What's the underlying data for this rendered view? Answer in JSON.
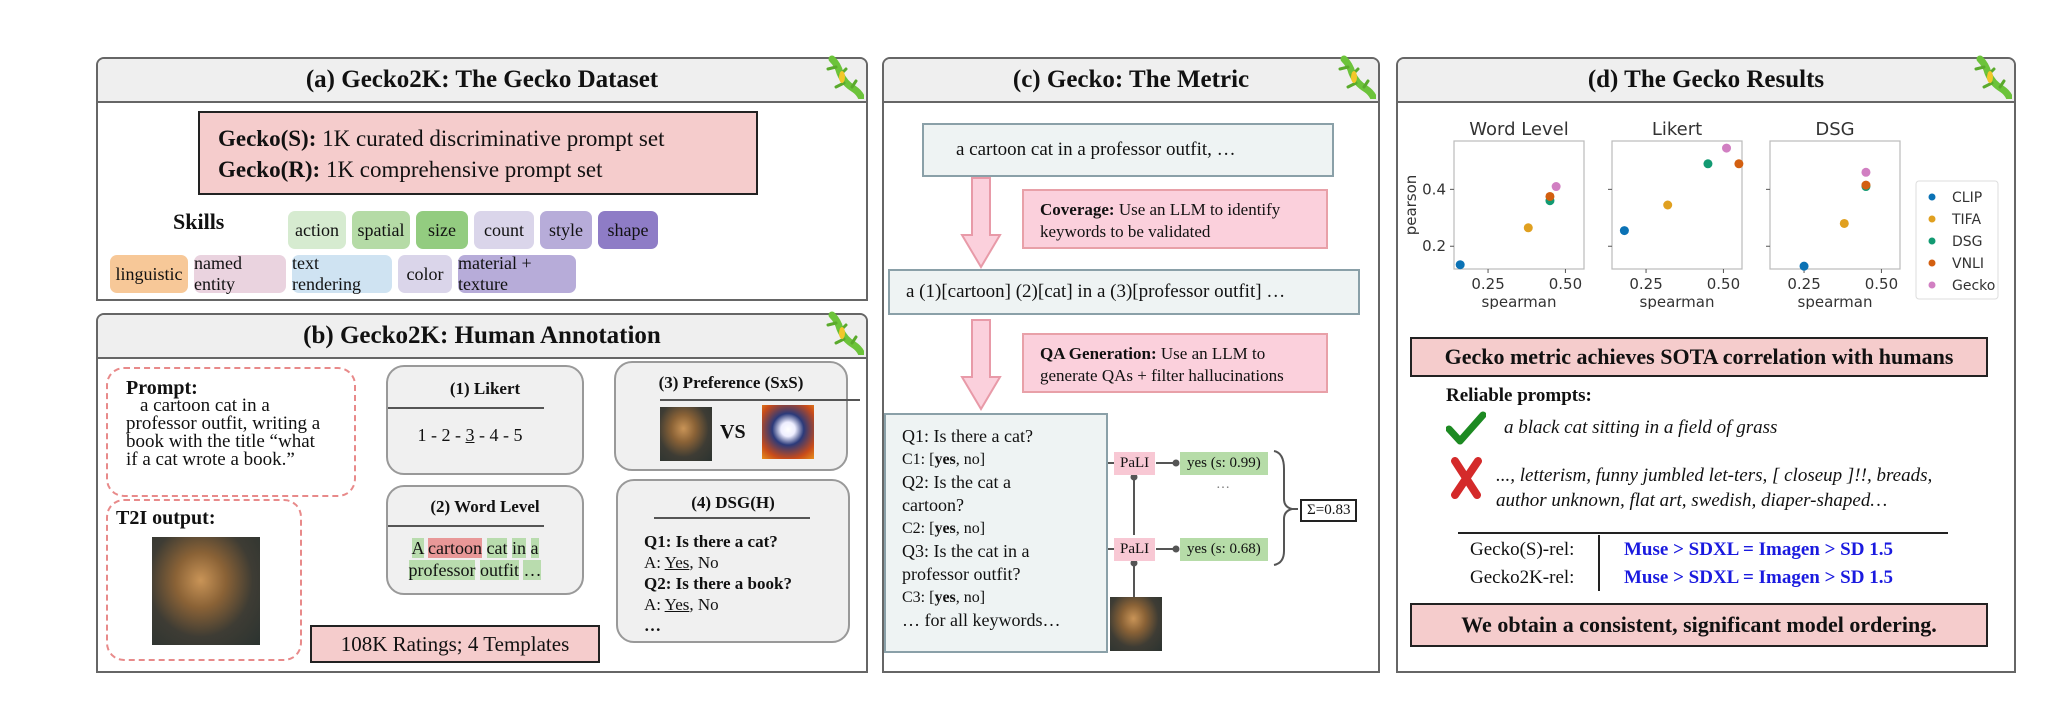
{
  "panel_a": {
    "title": "(a) Gecko2K: The Gecko Dataset",
    "sets": [
      {
        "name": "Gecko(S):",
        "desc": " 1K curated discriminative prompt set"
      },
      {
        "name": "Gecko(R):",
        "desc": " 1K comprehensive prompt set"
      }
    ],
    "skills_label": "Skills",
    "skills_row1": [
      {
        "label": "action",
        "color": "#d6ebd0"
      },
      {
        "label": "spatial",
        "color": "#b5dba6"
      },
      {
        "label": "size",
        "color": "#93cc80"
      },
      {
        "label": "count",
        "color": "#dad5ea"
      },
      {
        "label": "style",
        "color": "#b7acd9"
      },
      {
        "label": "shape",
        "color": "#8e7cc6"
      }
    ],
    "skills_row2": [
      {
        "label": "linguistic",
        "color": "#f7c898"
      },
      {
        "label": "named entity",
        "color": "#ead3df"
      },
      {
        "label": "text rendering",
        "color": "#cfe3f2"
      },
      {
        "label": "color",
        "color": "#dad5ea"
      },
      {
        "label": "material + texture",
        "color": "#b7acd9"
      }
    ]
  },
  "panel_b": {
    "title": "(b) Gecko2K: Human Annotation",
    "prompt_label": "Prompt:",
    "prompt_lines": [
      "a cartoon cat in a",
      "professor outfit, writing a",
      "book with the title “what",
      "if a cat wrote a book.”"
    ],
    "t2i_label": "T2I output:",
    "likert": {
      "title": "(1) Likert",
      "scale_pre": "1 - 2 - ",
      "scale_sel": "3",
      "scale_post": " - 4 - 5"
    },
    "word_level": {
      "title": "(2) Word Level",
      "line1": [
        {
          "w": "A",
          "ok": true
        },
        {
          "w": "cartoon",
          "ok": false
        },
        {
          "w": "cat",
          "ok": true
        },
        {
          "w": "in",
          "ok": true
        },
        {
          "w": "a",
          "ok": true
        }
      ],
      "line2": [
        {
          "w": "professor",
          "ok": true
        },
        {
          "w": "outfit",
          "ok": true
        },
        {
          "w": "…",
          "ok": true
        }
      ]
    },
    "preference": {
      "title": "(3) Preference (SxS)",
      "vs": "VS"
    },
    "dsg": {
      "title": "(4) DSG(H)",
      "q1": "Q1: Is there a cat?",
      "a1_pre": "A: ",
      "a1_sel": "Yes",
      "a1_post": ", No",
      "q2": "Q2: Is there a book?",
      "a2_pre": "A: ",
      "a2_sel": "Yes",
      "a2_post": ", No",
      "more": "…"
    },
    "ratings": "108K Ratings; 4 Templates"
  },
  "panel_c": {
    "title": "(c) Gecko: The Metric",
    "prompt": "a cartoon cat in a professor outfit, …",
    "coverage_bold": "Coverage:",
    "coverage_text": " Use an LLM to identify",
    "coverage_text2": "keywords to be validated",
    "keywords": "a (1)[cartoon] (2)[cat] in a (3)[professor outfit] …",
    "qa_bold": "QA Generation:",
    "qa_text": " Use an LLM to",
    "qa_text2": "generate QAs + filter hallucinations",
    "qas": [
      {
        "q": "Q1: Is there a cat?",
        "c_pre": "C1: [",
        "c_bold": "yes",
        "c_post": ", no]"
      },
      {
        "q": "Q2: Is the cat a",
        "q2": "cartoon?",
        "c_pre": "C2: [",
        "c_bold": "yes",
        "c_post": ", no]"
      },
      {
        "q": "Q3: Is the cat in a",
        "q2": "professor outfit?",
        "c_pre": "C3: [",
        "c_bold": "yes",
        "c_post": ", no]"
      }
    ],
    "qa_more": "… for all keywords…",
    "vqa_model": "PaLI",
    "answers": [
      "yes (s: 0.99)",
      "yes (s: 0.68)"
    ],
    "ellipsis": "…",
    "sum": "Σ=0.83"
  },
  "panel_d": {
    "title": "(d) The Gecko Results",
    "sota": "Gecko metric achieves SOTA correlation with humans",
    "reliable_label": "Reliable prompts:",
    "good_prompt": "a black cat sitting in a field of grass",
    "bad_prompt_1": "..., letterism, funny jumbled let-ters, [ closeup ]!!, breads,",
    "bad_prompt_2": "author unknown, flat art, swedish, diaper-shaped…",
    "rankings": [
      {
        "label": "Gecko(S)-rel:",
        "order": "Muse > SDXL = Imagen > SD 1.5"
      },
      {
        "label": "Gecko2K-rel:",
        "order": "Muse > SDXL = Imagen > SD 1.5"
      }
    ],
    "conclusion": "We obtain a consistent, significant model ordering."
  },
  "chart_data": [
    {
      "type": "scatter",
      "title": "Word Level",
      "xlabel": "spearman",
      "ylabel": "pearson",
      "xlim": [
        0.14,
        0.56
      ],
      "ylim": [
        0.12,
        0.57
      ],
      "xticks": [
        "0.25",
        "0.50"
      ],
      "yticks": [
        "0.2",
        "0.4"
      ],
      "series": [
        {
          "name": "CLIP",
          "x": 0.16,
          "y": 0.135
        },
        {
          "name": "TIFA",
          "x": 0.38,
          "y": 0.265
        },
        {
          "name": "DSG",
          "x": 0.45,
          "y": 0.36
        },
        {
          "name": "VNLI",
          "x": 0.45,
          "y": 0.375
        },
        {
          "name": "Gecko",
          "x": 0.47,
          "y": 0.41
        }
      ]
    },
    {
      "type": "scatter",
      "title": "Likert",
      "xlabel": "spearman",
      "ylabel": "",
      "xlim": [
        0.14,
        0.56
      ],
      "ylim": [
        0.12,
        0.57
      ],
      "xticks": [
        "0.25",
        "0.50"
      ],
      "yticks": [],
      "series": [
        {
          "name": "CLIP",
          "x": 0.18,
          "y": 0.255
        },
        {
          "name": "TIFA",
          "x": 0.32,
          "y": 0.345
        },
        {
          "name": "DSG",
          "x": 0.45,
          "y": 0.49
        },
        {
          "name": "VNLI",
          "x": 0.55,
          "y": 0.49
        },
        {
          "name": "Gecko",
          "x": 0.51,
          "y": 0.545
        }
      ]
    },
    {
      "type": "scatter",
      "title": "DSG",
      "xlabel": "spearman",
      "ylabel": "",
      "xlim": [
        0.14,
        0.56
      ],
      "ylim": [
        0.12,
        0.57
      ],
      "xticks": [
        "0.25",
        "0.50"
      ],
      "yticks": [],
      "series": [
        {
          "name": "CLIP",
          "x": 0.25,
          "y": 0.13
        },
        {
          "name": "TIFA",
          "x": 0.38,
          "y": 0.28
        },
        {
          "name": "DSG",
          "x": 0.45,
          "y": 0.41
        },
        {
          "name": "VNLI",
          "x": 0.45,
          "y": 0.415
        },
        {
          "name": "Gecko",
          "x": 0.45,
          "y": 0.46
        }
      ]
    }
  ],
  "legend": {
    "placement": "right",
    "entries": [
      {
        "name": "CLIP",
        "color": "#0b72b5"
      },
      {
        "name": "TIFA",
        "color": "#e0a020"
      },
      {
        "name": "DSG",
        "color": "#129a72"
      },
      {
        "name": "VNLI",
        "color": "#d35f10"
      },
      {
        "name": "Gecko",
        "color": "#d17fc2"
      }
    ]
  }
}
